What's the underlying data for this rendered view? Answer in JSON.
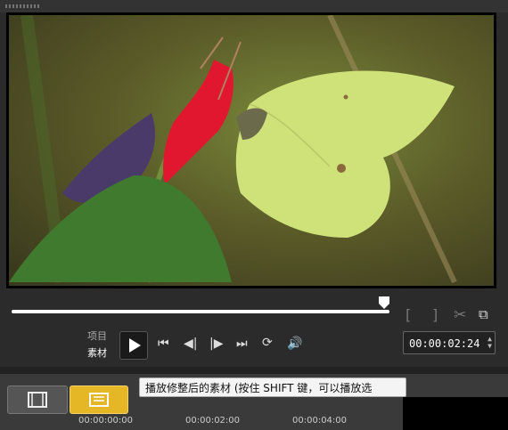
{
  "player": {
    "mode_labels": {
      "project": "项目",
      "clip": "素材"
    },
    "timecode": "00:00:02:24"
  },
  "tooltip": {
    "text": "播放修整后的素材 (按住 SHIFT 键，可以播放选"
  },
  "timeline": {
    "ticks": [
      "00:00:00:00",
      "00:00:02:00",
      "00:00:04:00"
    ]
  },
  "icons": [
    "mark-in-icon",
    "mark-out-icon",
    "cut-icon",
    "enlarge-icon",
    "play-icon",
    "home-icon",
    "prev-frame-icon",
    "next-frame-icon",
    "end-icon",
    "repeat-icon",
    "volume-icon",
    "spin-up-icon",
    "spin-down-icon",
    "storyboard-icon",
    "timeline-icon"
  ],
  "colors": {
    "accent": "#e5b625",
    "background": "#2b2b2b"
  }
}
